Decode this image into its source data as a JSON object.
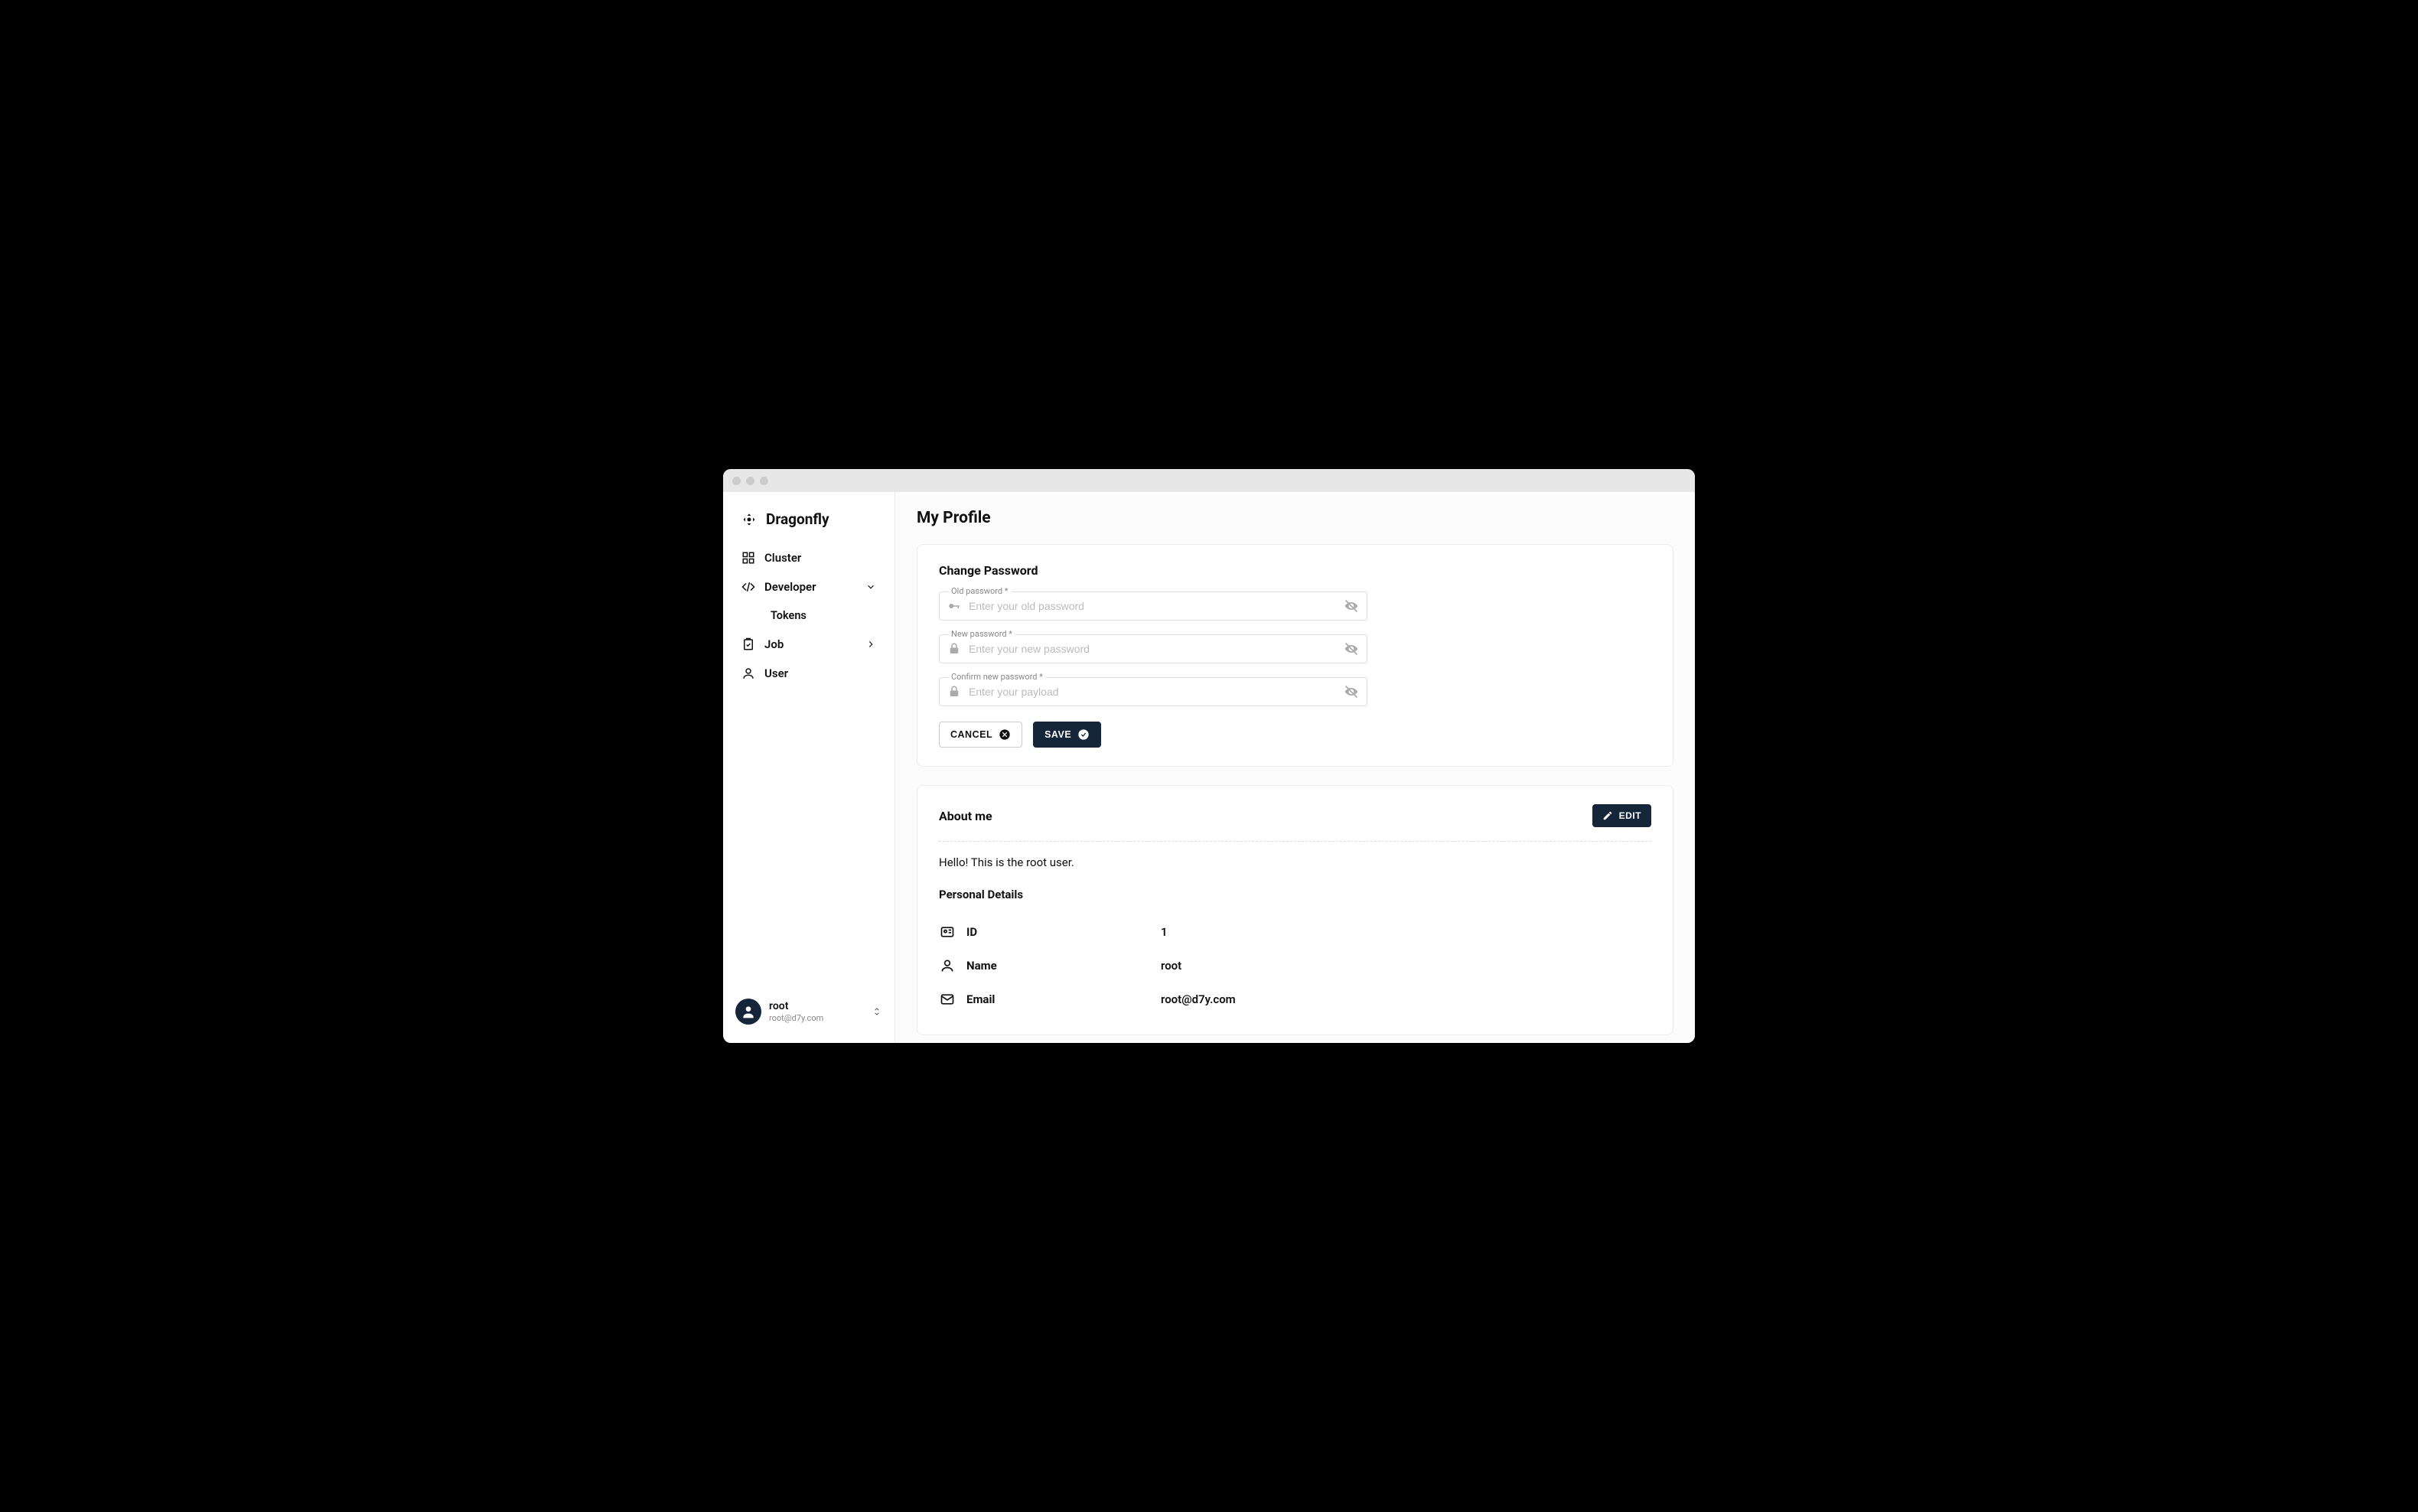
{
  "brand": "Dragonfly",
  "sidebar": {
    "items": [
      {
        "label": "Cluster"
      },
      {
        "label": "Developer",
        "expanded": true,
        "children": [
          {
            "label": "Tokens"
          }
        ]
      },
      {
        "label": "Job",
        "expanded": false
      },
      {
        "label": "User"
      }
    ]
  },
  "user": {
    "name": "root",
    "email": "root@d7y.com"
  },
  "page": {
    "title": "My Profile"
  },
  "changePassword": {
    "title": "Change Password",
    "old": {
      "label": "Old password *",
      "placeholder": "Enter your old password",
      "value": ""
    },
    "new": {
      "label": "New password *",
      "placeholder": "Enter your new password",
      "value": ""
    },
    "confirm": {
      "label": "Confirm new password *",
      "placeholder": "Enter your payload",
      "value": ""
    },
    "cancel": "CANCEL",
    "save": "SAVE"
  },
  "about": {
    "title": "About me",
    "edit": "EDIT",
    "hello": "Hello! This is the root user.",
    "detailsTitle": "Personal Details",
    "rows": [
      {
        "label": "ID",
        "value": "1"
      },
      {
        "label": "Name",
        "value": "root"
      },
      {
        "label": "Email",
        "value": "root@d7y.com"
      }
    ]
  },
  "colors": {
    "accent": "#15253a"
  }
}
